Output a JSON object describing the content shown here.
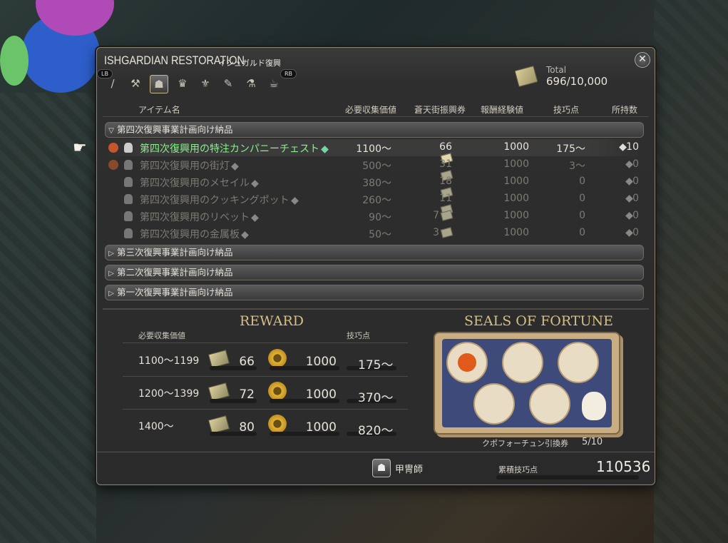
{
  "window": {
    "title": "ISHGARDIAN RESTORATION",
    "title_jp": "イシュガルド復興",
    "close_icon": "close-icon",
    "lb": "LB",
    "rb": "RB",
    "tabs": [
      {
        "icon": "carpenter-icon",
        "glyph": "/"
      },
      {
        "icon": "blacksmith-icon",
        "glyph": "⚒"
      },
      {
        "icon": "armorer-icon",
        "glyph": "☗"
      },
      {
        "icon": "goldsmith-icon",
        "glyph": "♛"
      },
      {
        "icon": "leatherworker-icon",
        "glyph": "⚜"
      },
      {
        "icon": "weaver-icon",
        "glyph": "✎"
      },
      {
        "icon": "alchemist-icon",
        "glyph": "⚗"
      },
      {
        "icon": "culinarian-icon",
        "glyph": "☕"
      }
    ],
    "active_tab": 2,
    "total_label": "Total",
    "total_value": "696/10,000"
  },
  "table": {
    "headers": {
      "item": "アイテム名",
      "collectability": "必要収集価値",
      "scrips": "蒼天街振興券",
      "exp": "報酬経験値",
      "skill": "技巧点",
      "owned": "所持数"
    },
    "categories": [
      {
        "label": "第四次復興事業計画向け納品",
        "expanded": true
      },
      {
        "label": "第三次復興事業計画向け納品",
        "expanded": false
      },
      {
        "label": "第二次復興事業計画向け納品",
        "expanded": false
      },
      {
        "label": "第一次復興事業計画向け納品",
        "expanded": false
      }
    ],
    "rows": [
      {
        "name": "第四次復興用の特注カンパニーチェスト",
        "collect": "1100〜",
        "scrips": "66",
        "exp": "1000",
        "skill": "175〜",
        "owned": "10",
        "selected": true
      },
      {
        "name": "第四次復興用の街灯",
        "collect": "500〜",
        "scrips": "31",
        "exp": "1000",
        "skill": "3〜",
        "owned": "0",
        "selected": false
      },
      {
        "name": "第四次復興用のメセイル",
        "collect": "380〜",
        "scrips": "18",
        "exp": "1000",
        "skill": "0",
        "owned": "0",
        "selected": false
      },
      {
        "name": "第四次復興用のクッキングポット",
        "collect": "260〜",
        "scrips": "11",
        "exp": "1000",
        "skill": "0",
        "owned": "0",
        "selected": false
      },
      {
        "name": "第四次復興用のリベット",
        "collect": "90〜",
        "scrips": "7",
        "exp": "1000",
        "skill": "0",
        "owned": "0",
        "selected": false
      },
      {
        "name": "第四次復興用の金属板",
        "collect": "50〜",
        "scrips": "3",
        "exp": "1000",
        "skill": "0",
        "owned": "0",
        "selected": false
      }
    ]
  },
  "reward": {
    "title": "REWARD",
    "col_collect": "必要収集価値",
    "col_skill": "技巧点",
    "rows": [
      {
        "range": "1100〜1199",
        "scrips": "66",
        "exp": "1000",
        "skill": "175〜"
      },
      {
        "range": "1200〜1399",
        "scrips": "72",
        "exp": "1000",
        "skill": "370〜"
      },
      {
        "range": "1400〜",
        "scrips": "80",
        "exp": "1000",
        "skill": "820〜"
      }
    ]
  },
  "seals": {
    "title": "SEALS OF FORTUNE",
    "label": "クポフォーチュン引換券",
    "count": "5/10"
  },
  "footer": {
    "job_name": "甲冑師",
    "total_skill_label": "累積技巧点",
    "total_skill_value": "110536"
  },
  "colors": {
    "accent_gold": "#d6bf84",
    "selected_text": "#8af08a",
    "frame": "#8c8372"
  }
}
